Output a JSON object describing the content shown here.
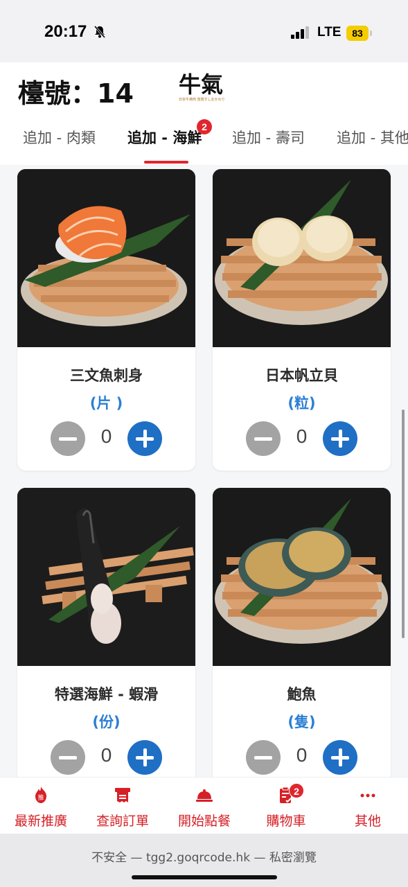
{
  "status_bar": {
    "time": "20:17",
    "network": "LTE",
    "battery": "83"
  },
  "header": {
    "table_number": "檯號：14",
    "logo": {
      "text": "牛氣",
      "subtext": "日本牛焼肉 放題すしおかわり"
    }
  },
  "tabs": [
    {
      "label": "追加 - 肉類"
    },
    {
      "label": "追加 - 海鮮",
      "badge": "2",
      "active": true
    },
    {
      "label": "追加 - 壽司"
    },
    {
      "label": "追加 - 其他"
    }
  ],
  "products": [
    {
      "name": "三文魚刺身",
      "unit": "(片 )",
      "quantity": "0",
      "image": "salmon-sashimi"
    },
    {
      "name": "日本帆立貝",
      "unit": "(粒)",
      "quantity": "0",
      "image": "scallop"
    },
    {
      "name": "特選海鮮 - 蝦滑",
      "unit": "(份)",
      "quantity": "0",
      "image": "shrimp-paste"
    },
    {
      "name": "鮑魚",
      "unit": "(隻)",
      "quantity": "0",
      "image": "abalone"
    }
  ],
  "bottom_nav": [
    {
      "label": "最新推廣",
      "icon": "promo-icon"
    },
    {
      "label": "查詢訂單",
      "icon": "receipt-icon"
    },
    {
      "label": "開始點餐",
      "icon": "cloche-icon"
    },
    {
      "label": "購物車",
      "icon": "cart-icon",
      "badge": "2"
    },
    {
      "label": "其他",
      "icon": "more-icon"
    }
  ],
  "browser": {
    "url_text": "不安全 — tgg2.goqrcode.hk — 私密瀏覽"
  },
  "colors": {
    "accent_red": "#d62027",
    "accent_blue": "#1f6fc5",
    "unit_blue": "#2a7fd4"
  }
}
